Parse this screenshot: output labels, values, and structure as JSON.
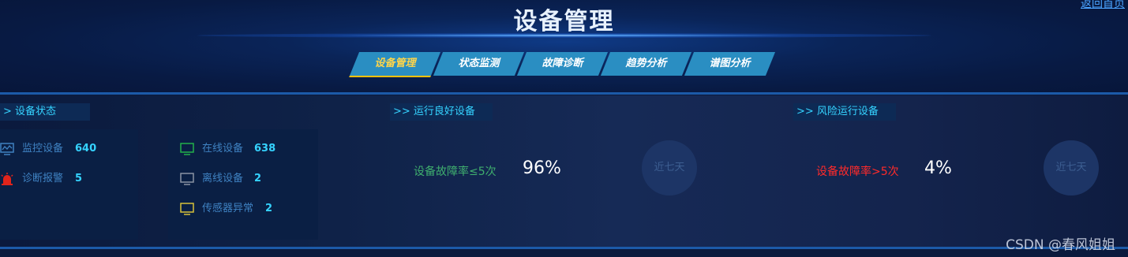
{
  "header": {
    "title": "设备管理",
    "back_link": "返回首页",
    "tabs": [
      {
        "label": "设备管理",
        "active": true
      },
      {
        "label": "状态监测",
        "active": false
      },
      {
        "label": "故障诊断",
        "active": false
      },
      {
        "label": "趋势分析",
        "active": false
      },
      {
        "label": "谱图分析",
        "active": false
      }
    ]
  },
  "device_status": {
    "title": "> 设备状态",
    "left_panel": [
      {
        "icon": "monitor-chart-icon",
        "label": "监控设备",
        "value": "640"
      },
      {
        "icon": "alarm-siren-icon",
        "label": "诊断报警",
        "value": "5"
      }
    ],
    "right_panel": [
      {
        "icon": "monitor-icon",
        "label": "在线设备",
        "value": "638",
        "color": "#22b04b"
      },
      {
        "icon": "monitor-icon",
        "label": "离线设备",
        "value": "2",
        "color": "#8a93a3"
      },
      {
        "icon": "monitor-icon",
        "label": "传感器异常",
        "value": "2",
        "color": "#d6c13a"
      }
    ]
  },
  "good_devices": {
    "title": ">> 运行良好设备",
    "label": "设备故障率≤5次",
    "value": "96%",
    "label_color": "#3fae6e",
    "button": "近七天"
  },
  "risk_devices": {
    "title": ">> 风险运行设备",
    "label": "设备故障率>5次",
    "value": "4%",
    "label_color": "#ff2a2a",
    "button": "近七天"
  },
  "watermark": "CSDN @春风姐姐"
}
